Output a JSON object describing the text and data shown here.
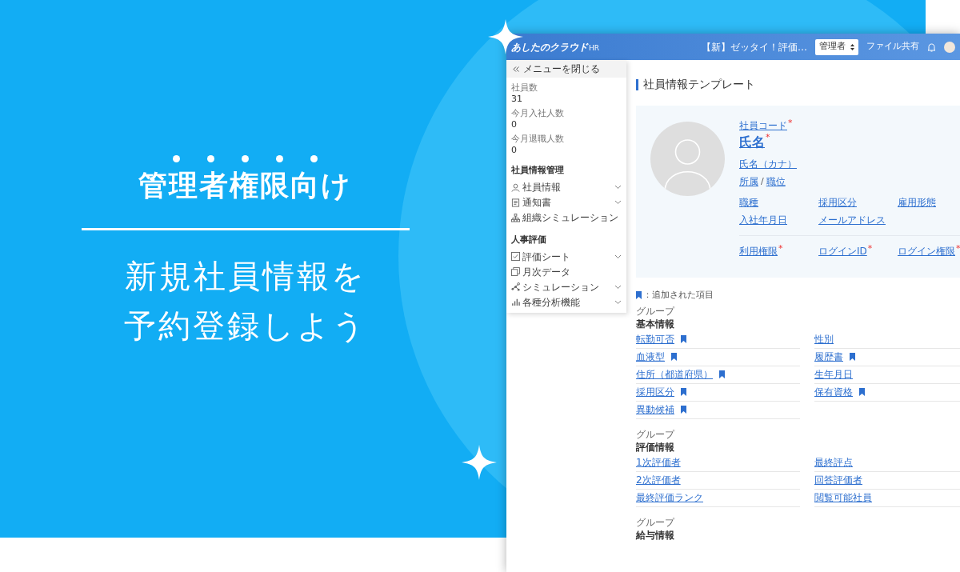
{
  "banner": {
    "tagline": "管理者権限向け",
    "headline_lines": [
      "新規社員情報を",
      "予約登録しよう"
    ]
  },
  "app": {
    "header": {
      "logo": "あしたのクラウド",
      "logo_suffix": "HR",
      "notice": "【新】ゼッタイ！評価…",
      "role_select": "管理者",
      "file_share": "ファイル共有"
    },
    "sidebar": {
      "close_menu": "メニューを閉じる",
      "stats": [
        {
          "label": "社員数",
          "value": "31"
        },
        {
          "label": "今月入社人数",
          "value": "0"
        },
        {
          "label": "今月退職人数",
          "value": "0"
        }
      ],
      "sections": [
        {
          "title": "社員情報管理",
          "items": [
            {
              "label": "社員情報",
              "expandable": true
            },
            {
              "label": "通知書",
              "expandable": true
            },
            {
              "label": "組織シミュレーション",
              "expandable": false
            }
          ]
        },
        {
          "title": "人事評価",
          "items": [
            {
              "label": "評価シート",
              "expandable": true
            },
            {
              "label": "月次データ",
              "expandable": false
            },
            {
              "label": "シミュレーション",
              "expandable": true
            },
            {
              "label": "各種分析機能",
              "expandable": true
            }
          ]
        }
      ]
    },
    "main": {
      "title": "社員情報テンプレート",
      "profile": {
        "required_mark": "*",
        "code": {
          "label": "社員コード",
          "required": true
        },
        "name": {
          "label": "氏名",
          "required": true
        },
        "kana": "氏名（カナ）",
        "affiliation": "所属",
        "separator": "/",
        "position": "職位",
        "fields": [
          {
            "label": "職種",
            "required": false
          },
          {
            "label": "採用区分",
            "required": false
          },
          {
            "label": "雇用形態",
            "required": false
          },
          {
            "label": "入社年月日",
            "required": false
          },
          {
            "label": "メールアドレス",
            "required": false
          }
        ],
        "account_fields": [
          {
            "label": "利用権限",
            "required": true
          },
          {
            "label": "ログインID",
            "required": true
          },
          {
            "label": "ログイン権限",
            "required": true
          }
        ]
      },
      "legend": "：追加された項目",
      "groups": [
        {
          "caption": "グループ",
          "title": "基本情報",
          "fields": [
            {
              "label": "転勤可否",
              "added": true
            },
            {
              "label": "性別",
              "added": false
            },
            {
              "label": "血液型",
              "added": true
            },
            {
              "label": "履歴書",
              "added": true
            },
            {
              "label": "住所（都道府県）",
              "added": true
            },
            {
              "label": "生年月日",
              "added": false
            },
            {
              "label": "採用区分",
              "added": true
            },
            {
              "label": "保有資格",
              "added": true
            },
            {
              "label": "異動候補",
              "added": true
            }
          ]
        },
        {
          "caption": "グループ",
          "title": "評価情報",
          "fields": [
            {
              "label": "1次評価者",
              "added": false
            },
            {
              "label": "最終評点",
              "added": false
            },
            {
              "label": "2次評価者",
              "added": false
            },
            {
              "label": "回答評価者",
              "added": false
            },
            {
              "label": "最終評価ランク",
              "added": false
            },
            {
              "label": "閲覧可能社員",
              "added": false
            }
          ]
        },
        {
          "caption": "グループ",
          "title": "給与情報"
        }
      ]
    }
  }
}
